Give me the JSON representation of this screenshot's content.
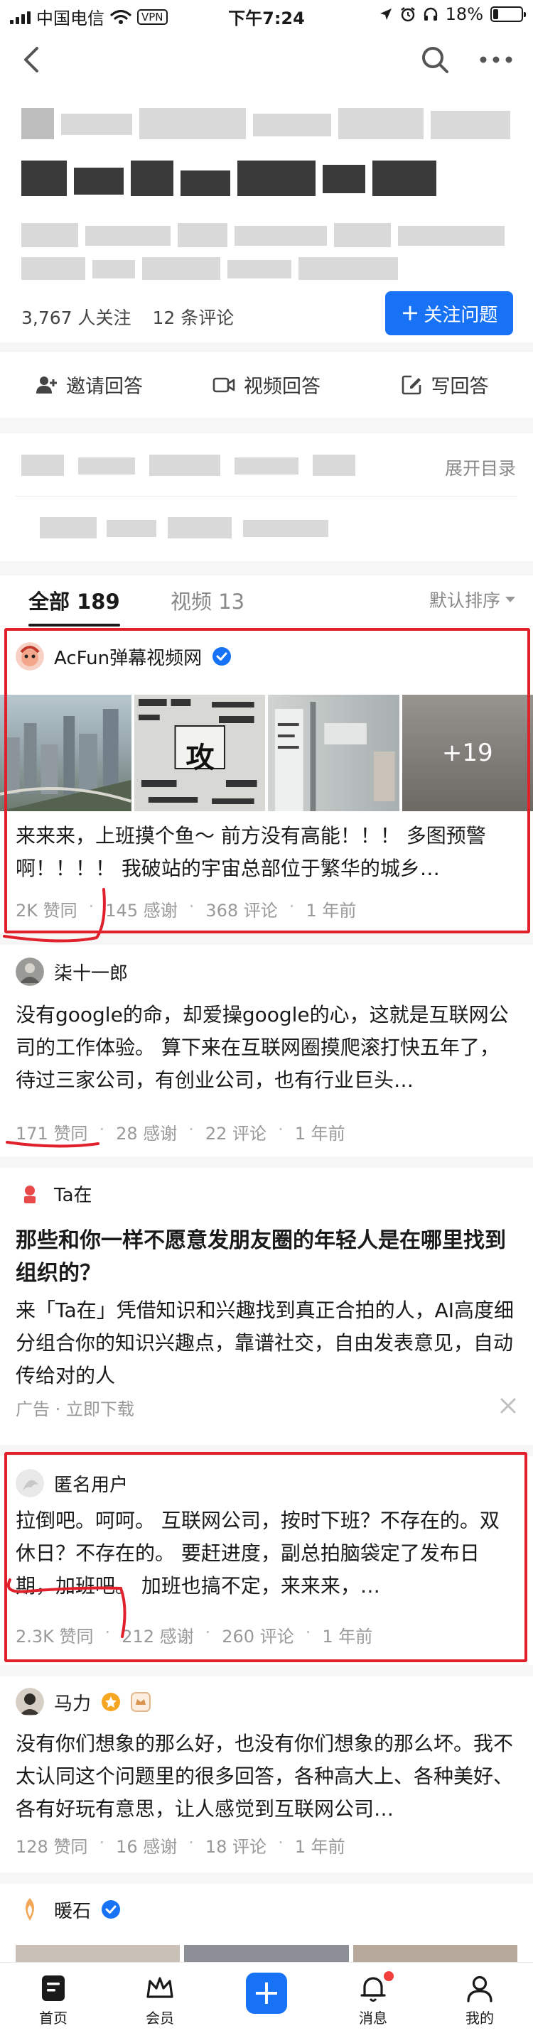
{
  "status_bar": {
    "carrier": "中国电信",
    "vpn": "VPN",
    "time": "下午7:24",
    "battery": "18%",
    "battery_level": 0.18
  },
  "question": {
    "followers": "3,767 人关注",
    "comments": "12 条评论",
    "follow_button": "关注问题"
  },
  "actions": [
    {
      "label": "邀请回答",
      "icon": "invite-icon"
    },
    {
      "label": "视频回答",
      "icon": "video-icon"
    },
    {
      "label": "写回答",
      "icon": "edit-icon"
    }
  ],
  "toc": {
    "expand_label": "展开目录"
  },
  "tabs": {
    "all": "全部 189",
    "video": "视频 13",
    "sort": "默认排序"
  },
  "answers": [
    {
      "author": "AcFun弹幕视频网",
      "verified": true,
      "text": "来来来，上班摸个鱼～ 前方没有高能！！！ 多图预警啊！！！！ 我破站的宇宙总部位于繁华的城乡…",
      "photo_more": "+19",
      "photo_sign": "攻",
      "upvotes": "2K 赞同",
      "thanks": "145 感谢",
      "comments": "368 评论",
      "time": "1 年前"
    },
    {
      "author": "柒十一郎",
      "text": "没有google的命，却爱操google的心，这就是互联网公司的工作体验。 算下来在互联网圈摸爬滚打快五年了，待过三家公司，有创业公司，也有行业巨头…",
      "upvotes": "171 赞同",
      "thanks": "28 感谢",
      "comments": "22 评论",
      "time": "1 年前"
    },
    {
      "author": "匿名用户",
      "text": "拉倒吧。呵呵。 互联网公司，按时下班？不存在的。双休日？不存在的。 要赶进度，副总拍脑袋定了发布日期，加班吧。 加班也搞不定，来来来，…",
      "upvotes": "2.3K 赞同",
      "thanks": "212 感谢",
      "comments": "260 评论",
      "time": "1 年前"
    },
    {
      "author": "马力",
      "text": "没有你们想象的那么好，也没有你们想象的那么坏。我不太认同这个问题里的很多回答，各种高大上、各种美好、各有好玩有意思，让人感觉到互联网公司…",
      "upvotes": "128 赞同",
      "thanks": "16 感谢",
      "comments": "18 评论",
      "time": "1 年前"
    },
    {
      "author": "暖石",
      "verified": true
    }
  ],
  "ad": {
    "brand": "Ta在",
    "title": "那些和你一样不愿意发朋友圈的年轻人是在哪里找到组织的？",
    "text": "来「Ta在」凭借知识和兴趣找到真正合拍的人，AI高度细分组合你的知识兴趣点，靠谱社交，自由发表意见，自动传给对的人",
    "label": "广告 · 立即下载"
  },
  "tabbar": [
    {
      "label": "首页",
      "icon": "home-icon"
    },
    {
      "label": "会员",
      "icon": "crown-icon"
    },
    {
      "label": "+",
      "icon": "plus-icon"
    },
    {
      "label": "消息",
      "icon": "bell-icon"
    },
    {
      "label": "我的",
      "icon": "profile-icon"
    }
  ],
  "colors": {
    "accent": "#1772f6",
    "highlight": "#e0202b",
    "text": "#1a1a1a",
    "muted": "#999999"
  }
}
